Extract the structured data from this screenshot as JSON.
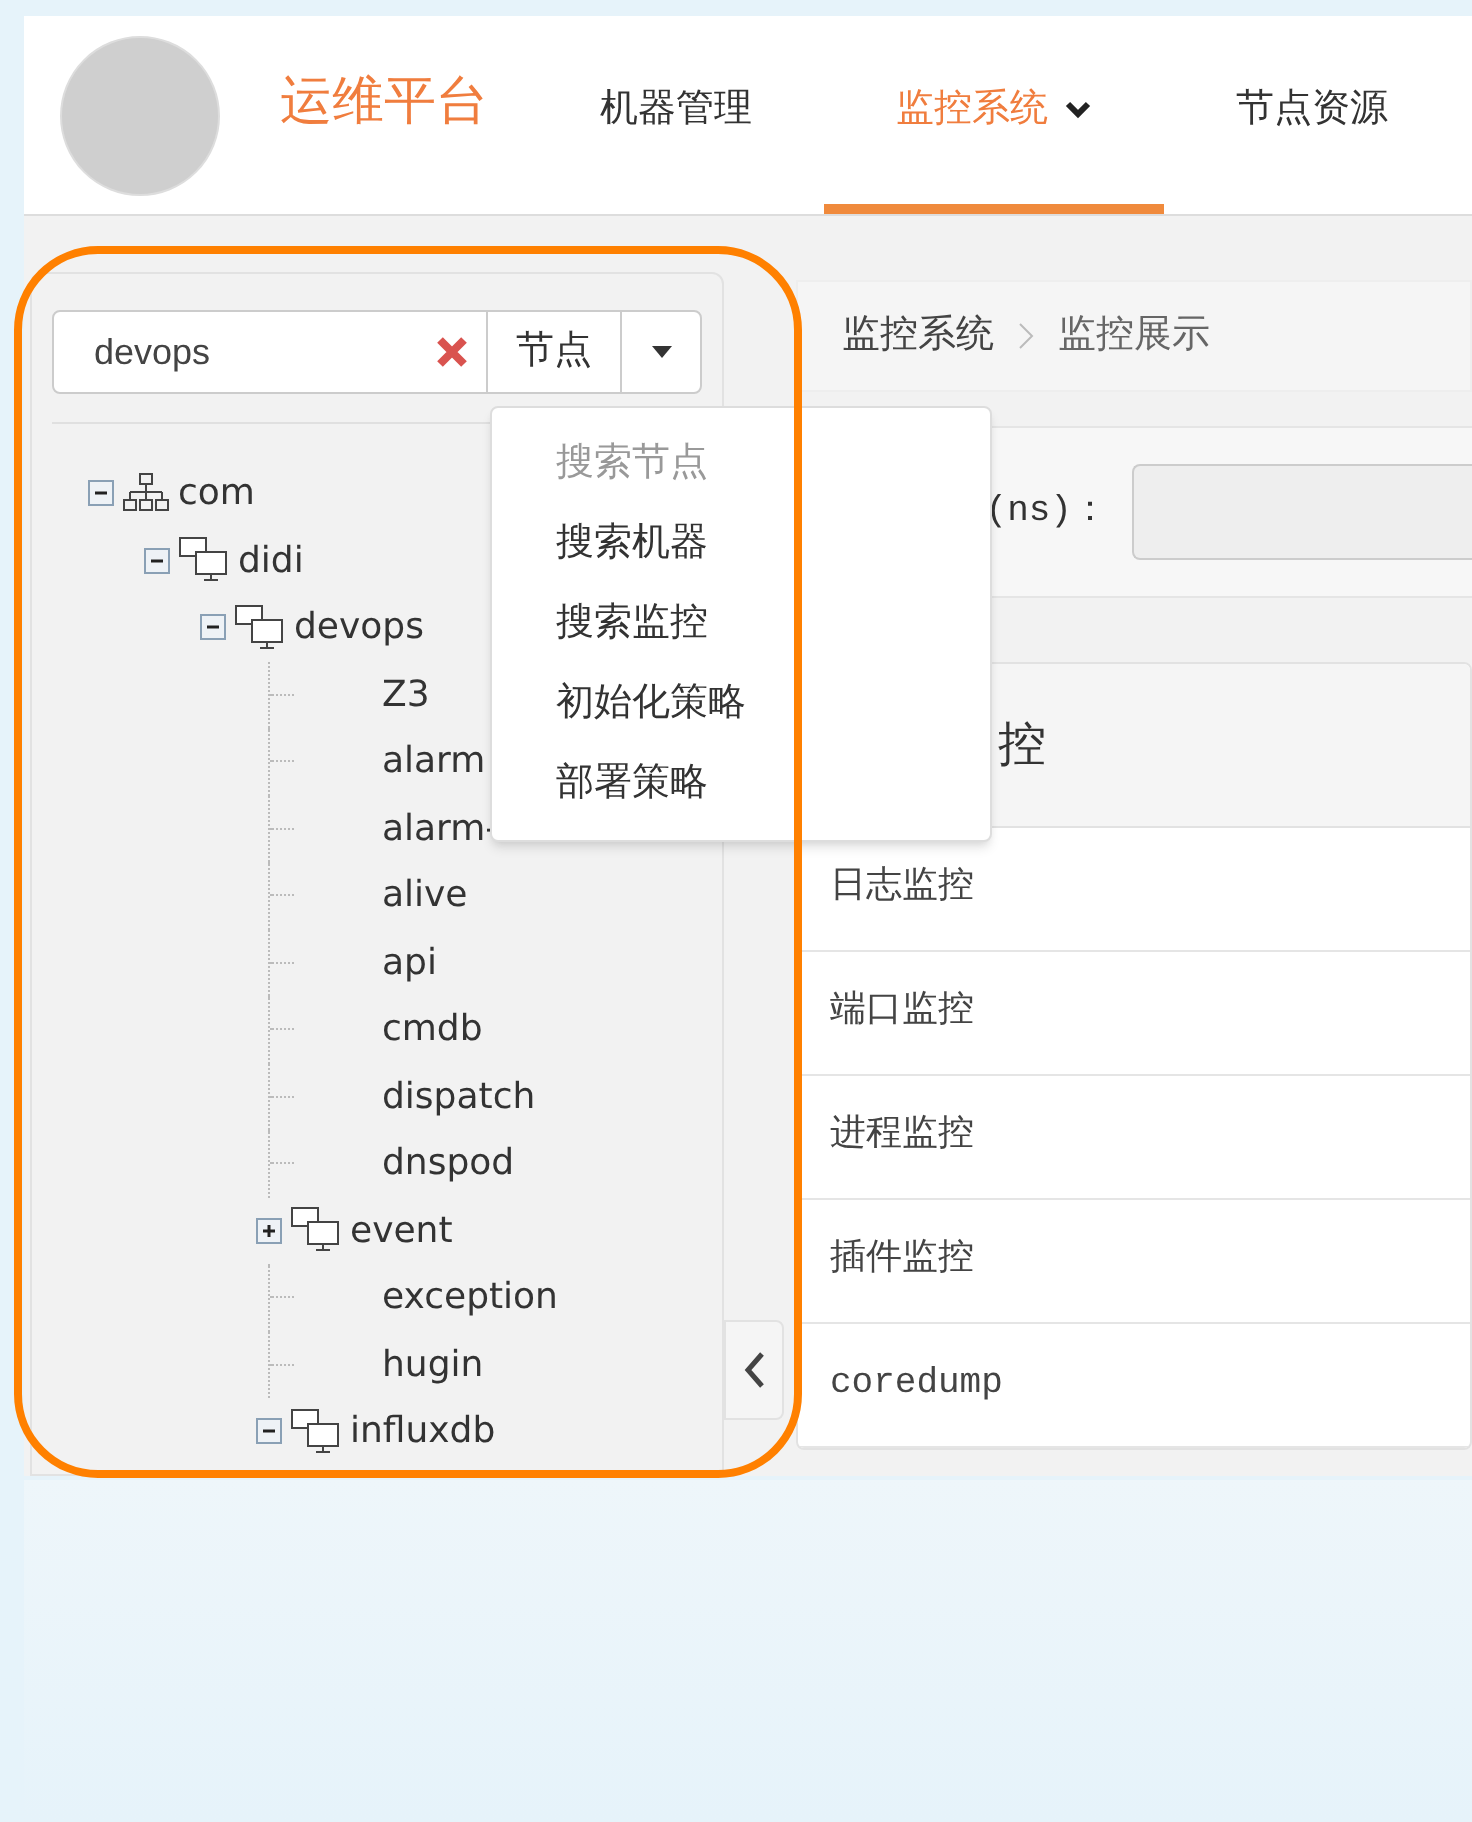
{
  "header": {
    "title": "运维平台",
    "nav": [
      {
        "label": "机器管理",
        "selected": false,
        "dropdown": false
      },
      {
        "label": "监控系统",
        "selected": true,
        "dropdown": true
      },
      {
        "label": "节点资源",
        "selected": false,
        "dropdown": false
      }
    ]
  },
  "sidebar": {
    "search": {
      "value": "devops",
      "scope": "节点"
    },
    "tree": [
      {
        "label": "com",
        "kind": "root",
        "expanded": true,
        "children": [
          {
            "label": "didi",
            "kind": "group",
            "expanded": true,
            "children": [
              {
                "label": "devops",
                "kind": "group",
                "expanded": true,
                "children": [
                  {
                    "label": "Z3",
                    "kind": "leaf"
                  },
                  {
                    "label": "alarm",
                    "kind": "leaf"
                  },
                  {
                    "label": "alarm-",
                    "kind": "leaf"
                  },
                  {
                    "label": "alive",
                    "kind": "leaf"
                  },
                  {
                    "label": "api",
                    "kind": "leaf"
                  },
                  {
                    "label": "cmdb",
                    "kind": "leaf"
                  },
                  {
                    "label": "dispatch",
                    "kind": "leaf"
                  },
                  {
                    "label": "dnspod",
                    "kind": "leaf"
                  },
                  {
                    "label": "event",
                    "kind": "group",
                    "expanded": false
                  },
                  {
                    "label": "exception",
                    "kind": "leaf"
                  },
                  {
                    "label": "hugin",
                    "kind": "leaf"
                  },
                  {
                    "label": "influxdb",
                    "kind": "group",
                    "expanded": true
                  }
                ]
              }
            ]
          }
        ]
      }
    ]
  },
  "search_menu": [
    {
      "label": "搜索节点",
      "disabled": true
    },
    {
      "label": "搜索机器",
      "disabled": false
    },
    {
      "label": "搜索监控",
      "disabled": false
    },
    {
      "label": "初始化策略",
      "disabled": false
    },
    {
      "label": "部署策略",
      "disabled": false
    }
  ],
  "breadcrumb": [
    "监控系统",
    "监控展示"
  ],
  "filter": {
    "label": "(ns)："
  },
  "monitor_panel": {
    "heading": "控",
    "items": [
      "日志监控",
      "端口监控",
      "进程监控",
      "插件监控",
      "coredump"
    ]
  }
}
